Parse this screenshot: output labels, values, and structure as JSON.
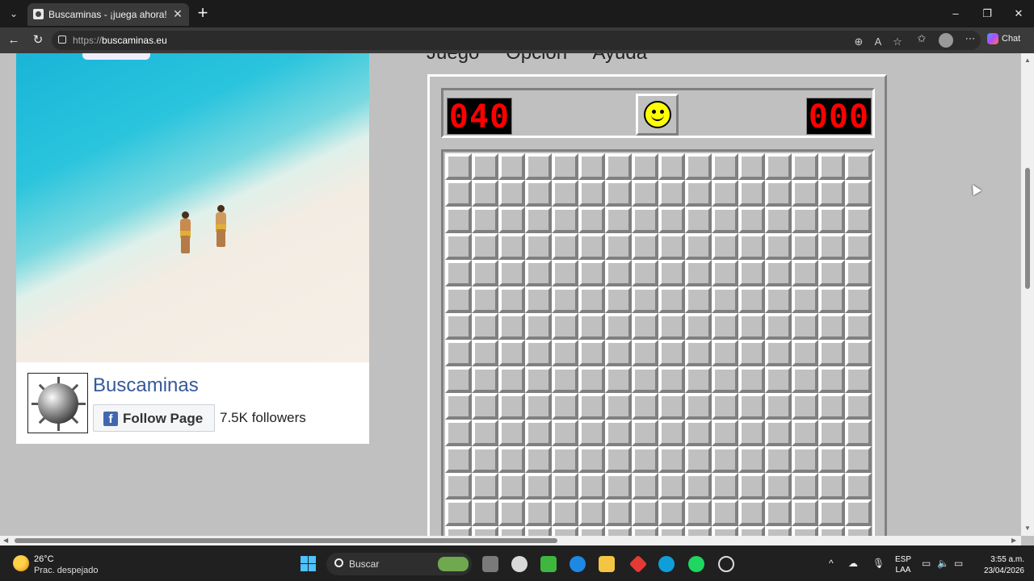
{
  "browser": {
    "tab_title": "Buscaminas - ¡juega ahora!",
    "tab_close": "✕",
    "new_tab": "+",
    "url_scheme": "https://",
    "url_host": "buscaminas.eu",
    "chat_label": "Chat",
    "window_controls": {
      "minimize": "–",
      "maximize": "❐",
      "close": "✕"
    }
  },
  "game": {
    "menu": [
      "Juego",
      "Opción",
      "Ayuda"
    ],
    "mine_counter": "040",
    "timer": "000",
    "rows": 16,
    "cols": 16,
    "colors": {
      "lcd_bg": "#000000",
      "lcd_digit": "#ff0000",
      "cell": "#c0c0c0",
      "smiley": "#ffff00"
    }
  },
  "facebook": {
    "page_name": "Buscaminas",
    "follow_label": "Follow Page",
    "followers": "7.5K followers",
    "brand_color": "#4267b2",
    "name_color": "#365899"
  },
  "taskbar": {
    "temperature": "26°C",
    "weather": "Prac. despejado",
    "search_label": "Buscar",
    "lang_top": "ESP",
    "lang_bottom": "LAA",
    "time": "3:55 a.m.",
    "date": "23/04/2026"
  }
}
